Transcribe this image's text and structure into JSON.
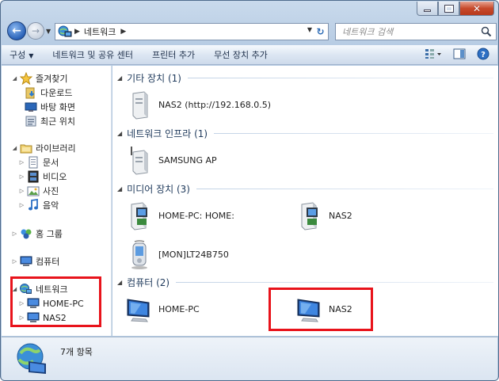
{
  "address": {
    "location": "네트워크"
  },
  "search": {
    "placeholder": "네트워크 검색"
  },
  "toolbar": {
    "organize": "구성",
    "network_sharing": "네트워크 및 공유 센터",
    "add_printer": "프린터 추가",
    "add_wireless": "무선 장치 추가"
  },
  "sidebar": {
    "favorites": "즐겨찾기",
    "downloads": "다운로드",
    "desktop": "바탕 화면",
    "recent": "최근 위치",
    "libraries": "라이브러리",
    "documents": "문서",
    "videos": "비디오",
    "pictures": "사진",
    "music": "음악",
    "homegroup": "홈 그룹",
    "computer": "컴퓨터",
    "network": "네트워크",
    "home_pc": "HOME-PC",
    "nas2": "NAS2"
  },
  "groups": {
    "other": {
      "title": "기타 장치 (1)",
      "items": [
        "NAS2 (http://192.168.0.5)"
      ]
    },
    "infra": {
      "title": "네트워크 인프라 (1)",
      "items": [
        "SAMSUNG AP"
      ]
    },
    "media": {
      "title": "미디어 장치 (3)",
      "items": [
        "HOME-PC: HOME:",
        "NAS2",
        "[MON]LT24B750"
      ]
    },
    "computers": {
      "title": "컴퓨터 (2)",
      "items": [
        "HOME-PC",
        "NAS2"
      ]
    }
  },
  "status": {
    "count": "7개 항목"
  },
  "colors": {
    "highlight": "#e8131b",
    "header": "#1e395b"
  }
}
